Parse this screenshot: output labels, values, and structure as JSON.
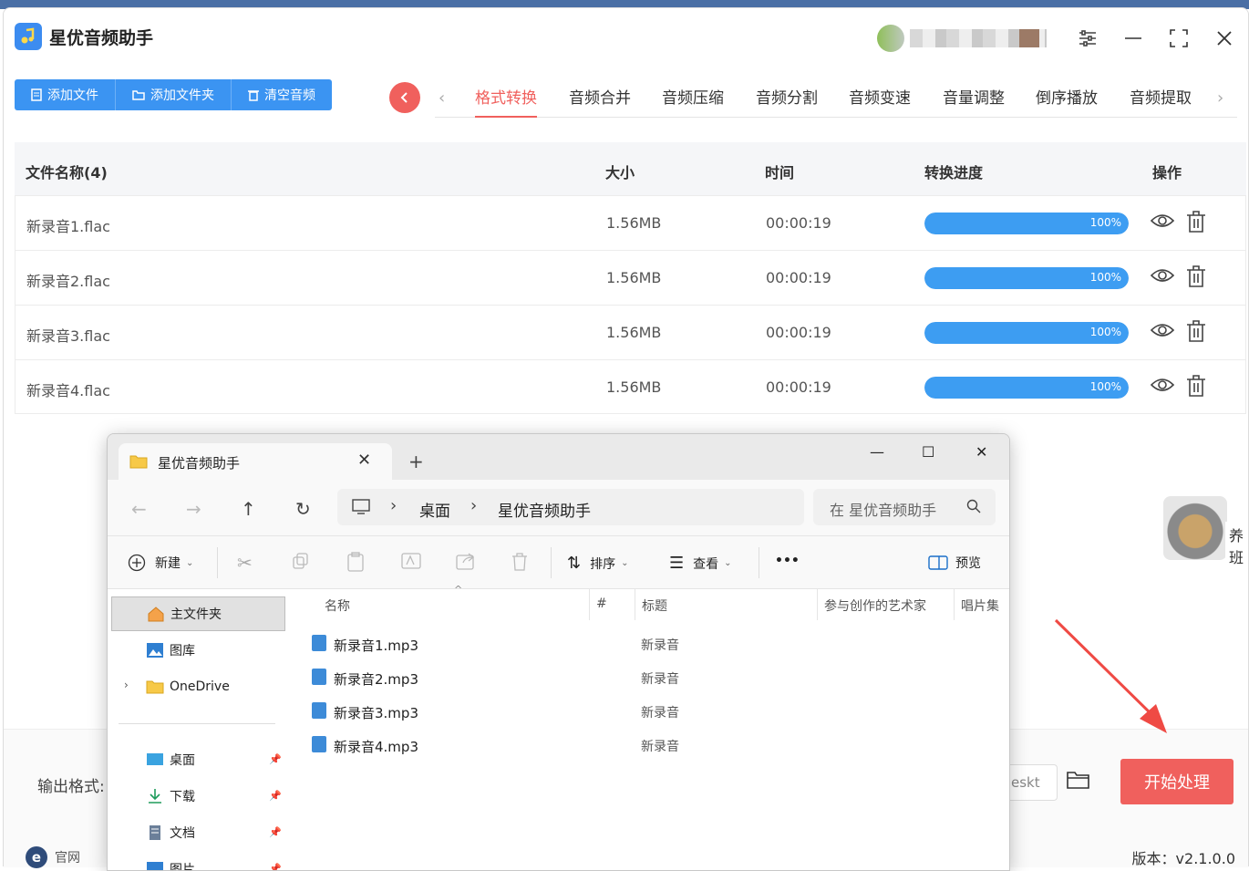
{
  "app": {
    "title": "星优音频助手",
    "toolbar": {
      "add_file": "添加文件",
      "add_folder": "添加文件夹",
      "clear": "清空音频"
    },
    "tabs": [
      "格式转换",
      "音频合并",
      "音频压缩",
      "音频分割",
      "音频变速",
      "音量调整",
      "倒序播放",
      "音频提取"
    ],
    "active_tab": "格式转换",
    "table": {
      "headers": {
        "name": "文件名称(4)",
        "size": "大小",
        "time": "时间",
        "progress": "转换进度",
        "ops": "操作"
      },
      "rows": [
        {
          "name": "新录音1.flac",
          "size": "1.56MB",
          "time": "00:00:19",
          "progress": "100%",
          "progress_value": 1.0
        },
        {
          "name": "新录音2.flac",
          "size": "1.56MB",
          "time": "00:00:19",
          "progress": "100%",
          "progress_value": 1.0
        },
        {
          "name": "新录音3.flac",
          "size": "1.56MB",
          "time": "00:00:19",
          "progress": "100%",
          "progress_value": 1.0
        },
        {
          "name": "新录音4.flac",
          "size": "1.56MB",
          "time": "00:00:19",
          "progress": "100%",
          "progress_value": 1.0
        }
      ]
    },
    "output_label": "输出格式:",
    "output_path": "eskt",
    "start_button": "开始处理",
    "site_link": "官网",
    "version": "版本：v2.1.0.0",
    "side_text": "养班",
    "colors": {
      "accent_blue": "#3b94f2",
      "accent_red": "#f0605d"
    }
  },
  "explorer": {
    "tab_title": "星优音频助手",
    "breadcrumb": [
      "桌面",
      "星优音频助手"
    ],
    "search_placeholder": "在 星优音频助手",
    "commands": {
      "new": "新建",
      "sort": "排序",
      "view": "查看",
      "more": "•••",
      "preview": "预览"
    },
    "nav": [
      {
        "label": "主文件夹",
        "icon": "home-icon"
      },
      {
        "label": "图库",
        "icon": "gallery-icon"
      },
      {
        "label": "OneDrive",
        "icon": "folder-icon"
      },
      {
        "label": "桌面",
        "icon": "desktop-icon"
      },
      {
        "label": "下载",
        "icon": "download-icon"
      },
      {
        "label": "文档",
        "icon": "document-icon"
      },
      {
        "label": "图片",
        "icon": "pictures-icon"
      }
    ],
    "columns": {
      "name": "名称",
      "num": "#",
      "title": "标题",
      "artist": "参与创作的艺术家",
      "album": "唱片集"
    },
    "files": [
      {
        "name": "新录音1.mp3",
        "title": "新录音"
      },
      {
        "name": "新录音2.mp3",
        "title": "新录音"
      },
      {
        "name": "新录音3.mp3",
        "title": "新录音"
      },
      {
        "name": "新录音4.mp3",
        "title": "新录音"
      }
    ]
  }
}
